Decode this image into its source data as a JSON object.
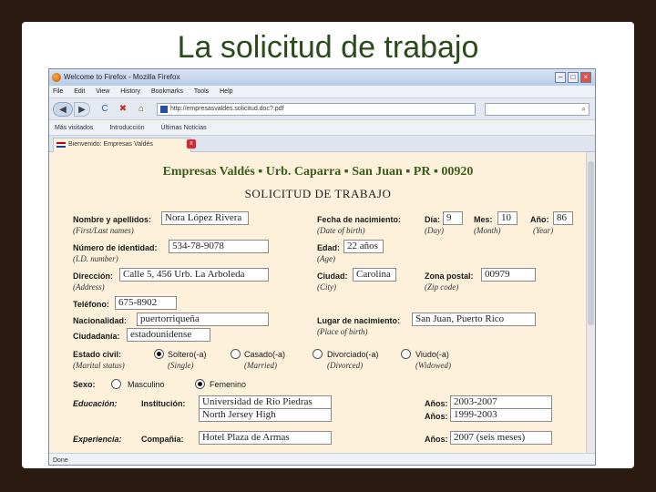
{
  "slide": {
    "title": "La solicitud de trabajo"
  },
  "window": {
    "title": "Welcome to Firefox - Mozilla Firefox",
    "minimize": "–",
    "maximize": "□",
    "close": "×"
  },
  "menu": [
    "File",
    "Edit",
    "View",
    "History",
    "Bookmarks",
    "Tools",
    "Help"
  ],
  "nav": {
    "back": "◀",
    "forward": "▶",
    "reload": "C",
    "stop": "✖",
    "home": "⌂",
    "url": "http://empresasvaldes.solicitud.doc?.pdf",
    "search_placeholder": ""
  },
  "bookmarks": [
    "Más visitados",
    "Introducción",
    "Últimas Noticias"
  ],
  "tab": {
    "label": "Bienvenido: Empresas Valdés",
    "close": "x"
  },
  "status": "Done",
  "form": {
    "company": "Empresas Valdés ▪ Urb. Caparra ▪ San Juan ▪ PR ▪ 00920",
    "title": "SOLICITUD DE TRABAJO",
    "name": {
      "label": "Nombre y apellidos:",
      "sub": "(First/Last names)",
      "value": "Nora López Rivera"
    },
    "dob": {
      "label": "Fecha de nacimiento:",
      "sub": "(Date of birth)"
    },
    "day": {
      "label": "Día:",
      "sub": "(Day)",
      "value": "9"
    },
    "month": {
      "label": "Mes:",
      "sub": "(Month)",
      "value": "10"
    },
    "year": {
      "label": "Año:",
      "sub": "(Year)",
      "value": "86"
    },
    "id": {
      "label": "Número de identidad:",
      "sub": "(I.D. number)",
      "value": "534-78-9078"
    },
    "age": {
      "label": "Edad:",
      "sub": "(Age)",
      "value": "22 años"
    },
    "address": {
      "label": "Dirección:",
      "sub": "(Address)",
      "value": "Calle 5, 456 Urb. La Arboleda"
    },
    "city": {
      "label": "Ciudad:",
      "sub": "(City)",
      "value": "Carolina"
    },
    "zip": {
      "label": "Zona postal:",
      "sub": "(Zip code)",
      "value": "00979"
    },
    "phone": {
      "label": "Teléfono:",
      "value": "675-8902"
    },
    "nationality": {
      "label": "Nacionalidad:",
      "value": "puertorriqueña"
    },
    "birthplace": {
      "label": "Lugar de nacimiento:",
      "sub": "(Place of birth)",
      "value": "San Juan, Puerto Rico"
    },
    "citizenship": {
      "label": "Ciudadanía:",
      "value": "estadounidense"
    },
    "marital": {
      "label": "Estado civil:",
      "sub": "(Marital status)",
      "options": [
        {
          "label": "Soltero(-a)",
          "sub": "(Single)",
          "selected": true
        },
        {
          "label": "Casado(-a)",
          "sub": "(Married)",
          "selected": false
        },
        {
          "label": "Divorciado(-a)",
          "sub": "(Divorced)",
          "selected": false
        },
        {
          "label": "Viudo(-a)",
          "sub": "(Widowed)",
          "selected": false
        }
      ]
    },
    "sex": {
      "label": "Sexo:",
      "options": [
        {
          "label": "Masculino",
          "selected": false
        },
        {
          "label": "Femenino",
          "selected": true
        }
      ]
    },
    "education": {
      "label": "Educación:",
      "inst_label": "Institución:",
      "years_label": "Años:",
      "rows": [
        {
          "institution": "Universidad de Río Piedras",
          "years": "2003-2007"
        },
        {
          "institution": "North Jersey High",
          "years": "1999-2003"
        }
      ]
    },
    "experience": {
      "label": "Experiencia:",
      "company_label": "Compañía:",
      "company": "Hotel Plaza de Armas",
      "years_label": "Años:",
      "years": "2007 (seis meses)"
    }
  }
}
